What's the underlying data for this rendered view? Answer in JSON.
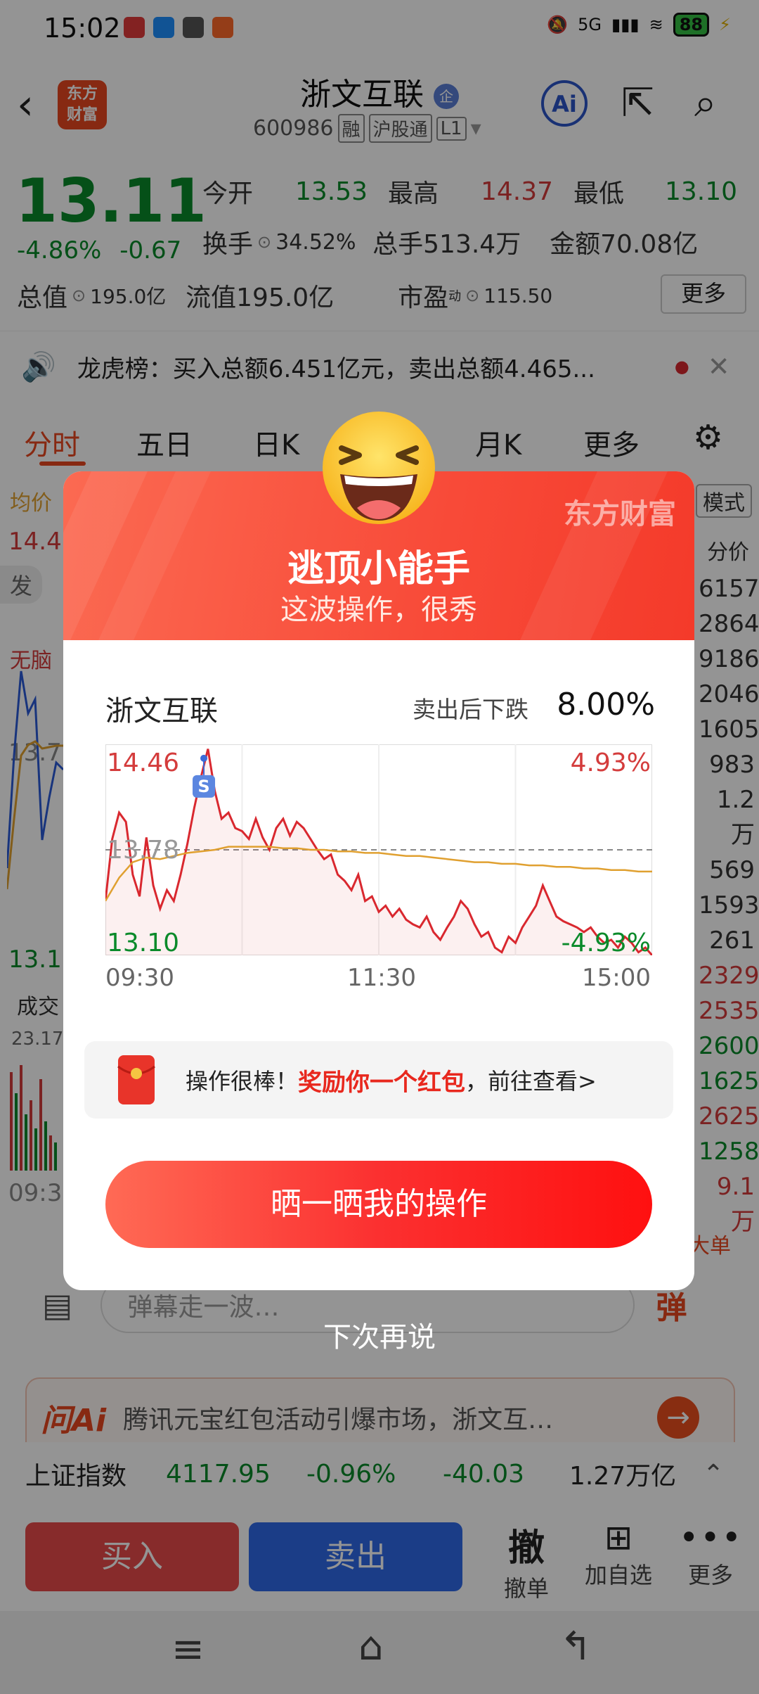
{
  "status_bar": {
    "time": "15:02",
    "network": "5G",
    "battery": "88"
  },
  "header": {
    "title": "浙文互联",
    "title_badge": "企",
    "code": "600986",
    "tags": [
      "融",
      "沪股通",
      "L1"
    ],
    "ai_label": "Ai"
  },
  "logo_text": "东方\n财富",
  "quote": {
    "price": "13.11",
    "change_pct": "-4.86%",
    "change_abs": "-0.67",
    "open_label": "今开",
    "open": "13.53",
    "high_label": "最高",
    "high": "14.37",
    "low_label": "最低",
    "low": "13.10",
    "turnover_label": "换手",
    "turnover": "34.52%",
    "volume_label": "总手",
    "volume": "513.4万",
    "amount_label": "金额",
    "amount": "70.08亿",
    "mcap_label": "总值",
    "mcap": "195.0亿",
    "float_label": "流值",
    "float": "195.0亿",
    "pe_label": "市盈",
    "pe_sup": "动",
    "pe": "115.50",
    "more": "更多"
  },
  "notice": "龙虎榜：买入总额6.451亿元，卖出总额4.465...",
  "tabs": [
    "分时",
    "五日",
    "日K",
    "月K",
    "更多",
    "模式"
  ],
  "background_chart": {
    "avg_label": "均价",
    "price_left": "14.4",
    "mid_left": "13.7",
    "low_left": "13.1",
    "volume_label": "成交",
    "volume_value": "23.17",
    "time_left": "09:3",
    "badge_left": "发",
    "badge_left2": "无脑",
    "right_header": "分价",
    "right_values": [
      "6157",
      "2864",
      "9186",
      "2046",
      "1605",
      "983",
      "1.2万",
      "569",
      "1593",
      "261",
      "2329",
      "2535",
      "2600",
      "1625",
      "2625",
      "1258",
      "9.1万"
    ],
    "big_order": "大单"
  },
  "comment_bar": {
    "placeholder": "弹幕走一波…",
    "danmu": "弹"
  },
  "ai_banner": {
    "label": "问Ai",
    "text": "腾讯元宝红包活动引爆市场，浙文互…"
  },
  "index_bar": {
    "name": "上证指数",
    "value": "4117.95",
    "pct": "-0.96%",
    "chg": "-40.03",
    "amount": "1.27万亿"
  },
  "trade_bar": {
    "buy": "买入",
    "sell": "卖出",
    "cancel_icon": "撤",
    "cancel": "撤单",
    "add": "加自选",
    "more": "更多"
  },
  "modal": {
    "brand": "东方财富",
    "title": "逃顶小能手",
    "subtitle": "这波操作，很秀",
    "stock_name": "浙文互联",
    "drop_label": "卖出后下跌",
    "drop_value": "8.00%",
    "sell_marker": "S",
    "reward_prefix": "操作很棒！",
    "reward_highlight": "奖励你一个红包",
    "reward_suffix": "，前往查看>",
    "share_button": "晒一晒我的操作",
    "dismiss": "下次再说"
  },
  "chart_data": {
    "type": "line",
    "x_ticks": [
      "09:30",
      "11:30",
      "15:00"
    ],
    "y_left_ticks": [
      "14.46",
      "13.78",
      "13.10"
    ],
    "y_right_ticks": [
      "4.93%",
      "-4.93%"
    ],
    "ylim": [
      13.1,
      14.46
    ],
    "prev_close": 13.78,
    "sell_point": {
      "time_fraction": 0.18,
      "price": 14.37
    },
    "series": [
      {
        "name": "price",
        "color": "#d9282f",
        "values": [
          13.45,
          13.85,
          14.02,
          13.96,
          13.62,
          13.48,
          13.86,
          13.55,
          13.4,
          13.52,
          13.45,
          13.62,
          13.82,
          14.05,
          14.25,
          14.43,
          14.16,
          13.98,
          14.02,
          13.92,
          13.9,
          13.85,
          13.98,
          13.86,
          13.78,
          13.92,
          13.98,
          13.87,
          13.96,
          13.92,
          13.85,
          13.78,
          13.72,
          13.75,
          13.62,
          13.58,
          13.52,
          13.62,
          13.45,
          13.48,
          13.38,
          13.42,
          13.35,
          13.4,
          13.33,
          13.3,
          13.28,
          13.35,
          13.25,
          13.2,
          13.28,
          13.35,
          13.45,
          13.4,
          13.3,
          13.22,
          13.25,
          13.15,
          13.12,
          13.22,
          13.18,
          13.28,
          13.35,
          13.42,
          13.55,
          13.45,
          13.35,
          13.32,
          13.3,
          13.28,
          13.25,
          13.28,
          13.22,
          13.18,
          13.2,
          13.15,
          13.22,
          13.18,
          13.12,
          13.15,
          13.1
        ]
      },
      {
        "name": "avg",
        "color": "#e0a030",
        "values": [
          13.45,
          13.6,
          13.7,
          13.73,
          13.72,
          13.74,
          13.76,
          13.77,
          13.78,
          13.8,
          13.8,
          13.8,
          13.8,
          13.79,
          13.79,
          13.78,
          13.78,
          13.77,
          13.77,
          13.76,
          13.76,
          13.75,
          13.74,
          13.74,
          13.73,
          13.72,
          13.71,
          13.7,
          13.7,
          13.69,
          13.69,
          13.68,
          13.68,
          13.67,
          13.67,
          13.66,
          13.66,
          13.65,
          13.65,
          13.64,
          13.64
        ]
      }
    ]
  }
}
